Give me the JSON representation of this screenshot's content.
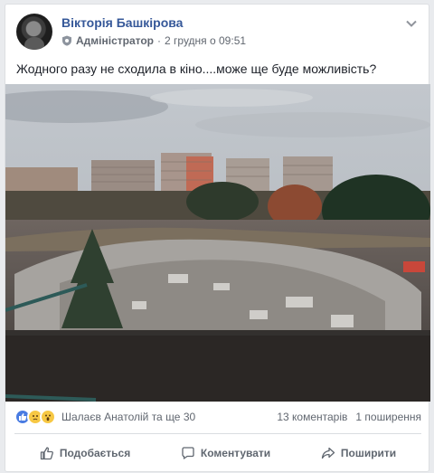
{
  "post": {
    "author": "Вікторія Башкірова",
    "role": "Адміністратор",
    "separator": "·",
    "timestamp": "2 грудня о 09:51",
    "text": "Жодного разу не сходила в кіно....може ще буде можливість?"
  },
  "reactions": {
    "icons": [
      "like-icon",
      "sad-icon",
      "wow-icon"
    ],
    "names": "Шалаєв Анатолій та ще 30",
    "comments": "13 коментарів",
    "shares": "1 поширення"
  },
  "actions": {
    "like_label": "Подобається",
    "comment_label": "Коментувати",
    "share_label": "Поширити"
  },
  "colors": {
    "author_link": "#365899",
    "meta_text": "#616770",
    "like_blue": "#4a7ce2",
    "emoji_yellow": "#f7c844"
  }
}
